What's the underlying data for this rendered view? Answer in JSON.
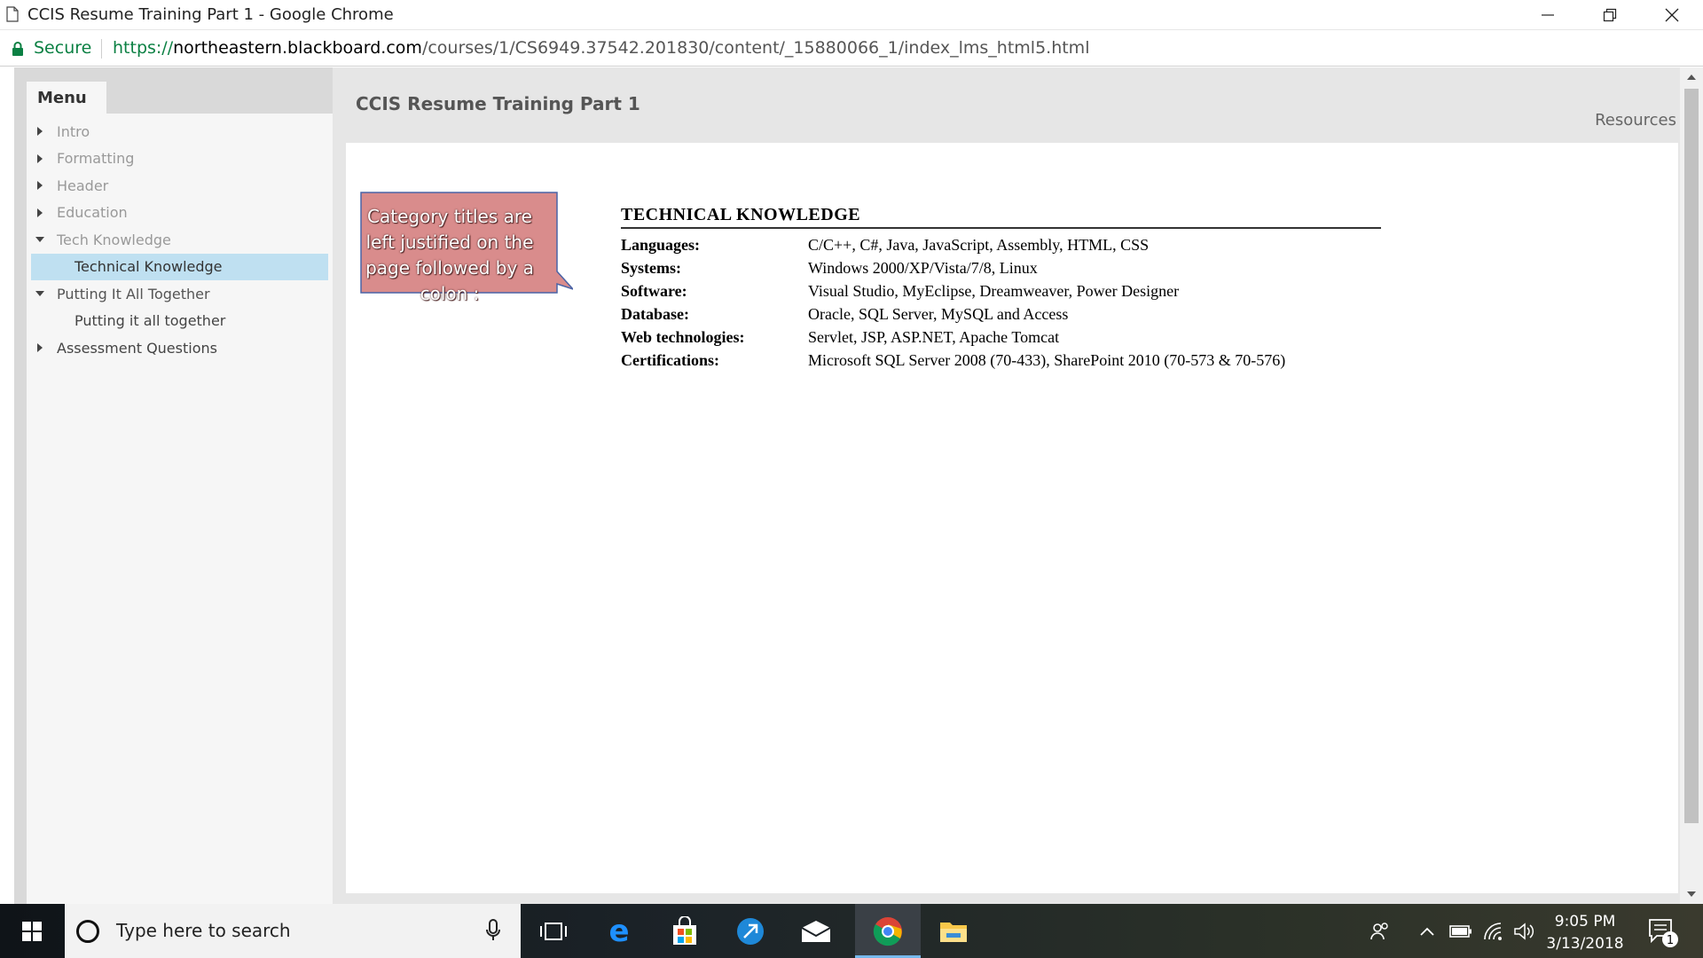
{
  "window": {
    "title": "CCIS Resume Training Part 1 - Google Chrome"
  },
  "addressbar": {
    "secure_label": "Secure",
    "url_scheme": "https://",
    "url_host": "northeastern.blackboard.com",
    "url_path": "/courses/1/CS6949.37542.201830/content/_15880066_1/index_lms_html5.html"
  },
  "sidebar": {
    "menu_title": "Menu",
    "items": [
      {
        "label": "Intro",
        "level": 0,
        "expanded": false
      },
      {
        "label": "Formatting",
        "level": 0,
        "expanded": false
      },
      {
        "label": "Header",
        "level": 0,
        "expanded": false
      },
      {
        "label": "Education",
        "level": 0,
        "expanded": false
      },
      {
        "label": "Tech Knowledge",
        "level": 0,
        "expanded": true
      },
      {
        "label": "Technical Knowledge",
        "level": 1,
        "active": true
      },
      {
        "label": "Putting It All Together",
        "level": 0,
        "expanded": true
      },
      {
        "label": "Putting it all together",
        "level": 1,
        "active": false
      },
      {
        "label": "Assessment Questions",
        "level": 0,
        "expanded": false
      }
    ]
  },
  "main": {
    "course_title": "CCIS Resume Training Part 1",
    "resources_label": "Resources"
  },
  "slide": {
    "callout_text": "Category titles are left justified on the page followed by a colon :",
    "callout_color": "#d98c8c",
    "resume_heading": "TECHNICAL KNOWLEDGE",
    "rows": [
      {
        "key": "Languages:",
        "value": "C/C++, C#, Java, JavaScript, Assembly, HTML, CSS"
      },
      {
        "key": "Systems:",
        "value": "Windows 2000/XP/Vista/7/8, Linux"
      },
      {
        "key": "Software:",
        "value": "Visual Studio, MyEclipse, Dreamweaver, Power Designer"
      },
      {
        "key": "Database:",
        "value": "Oracle, SQL Server, MySQL and Access"
      },
      {
        "key": "Web technologies:",
        "value": "Servlet, JSP, ASP.NET, Apache Tomcat"
      },
      {
        "key": "Certifications:",
        "value": "Microsoft SQL Server 2008 (70-433), SharePoint 2010 (70-573 & 70-576)"
      }
    ]
  },
  "taskbar": {
    "search_placeholder": "Type here to search",
    "time": "9:05 PM",
    "date": "3/13/2018",
    "notification_count": "1",
    "apps": [
      "task-view",
      "edge",
      "store",
      "link-app",
      "mail",
      "chrome",
      "file-explorer"
    ]
  }
}
